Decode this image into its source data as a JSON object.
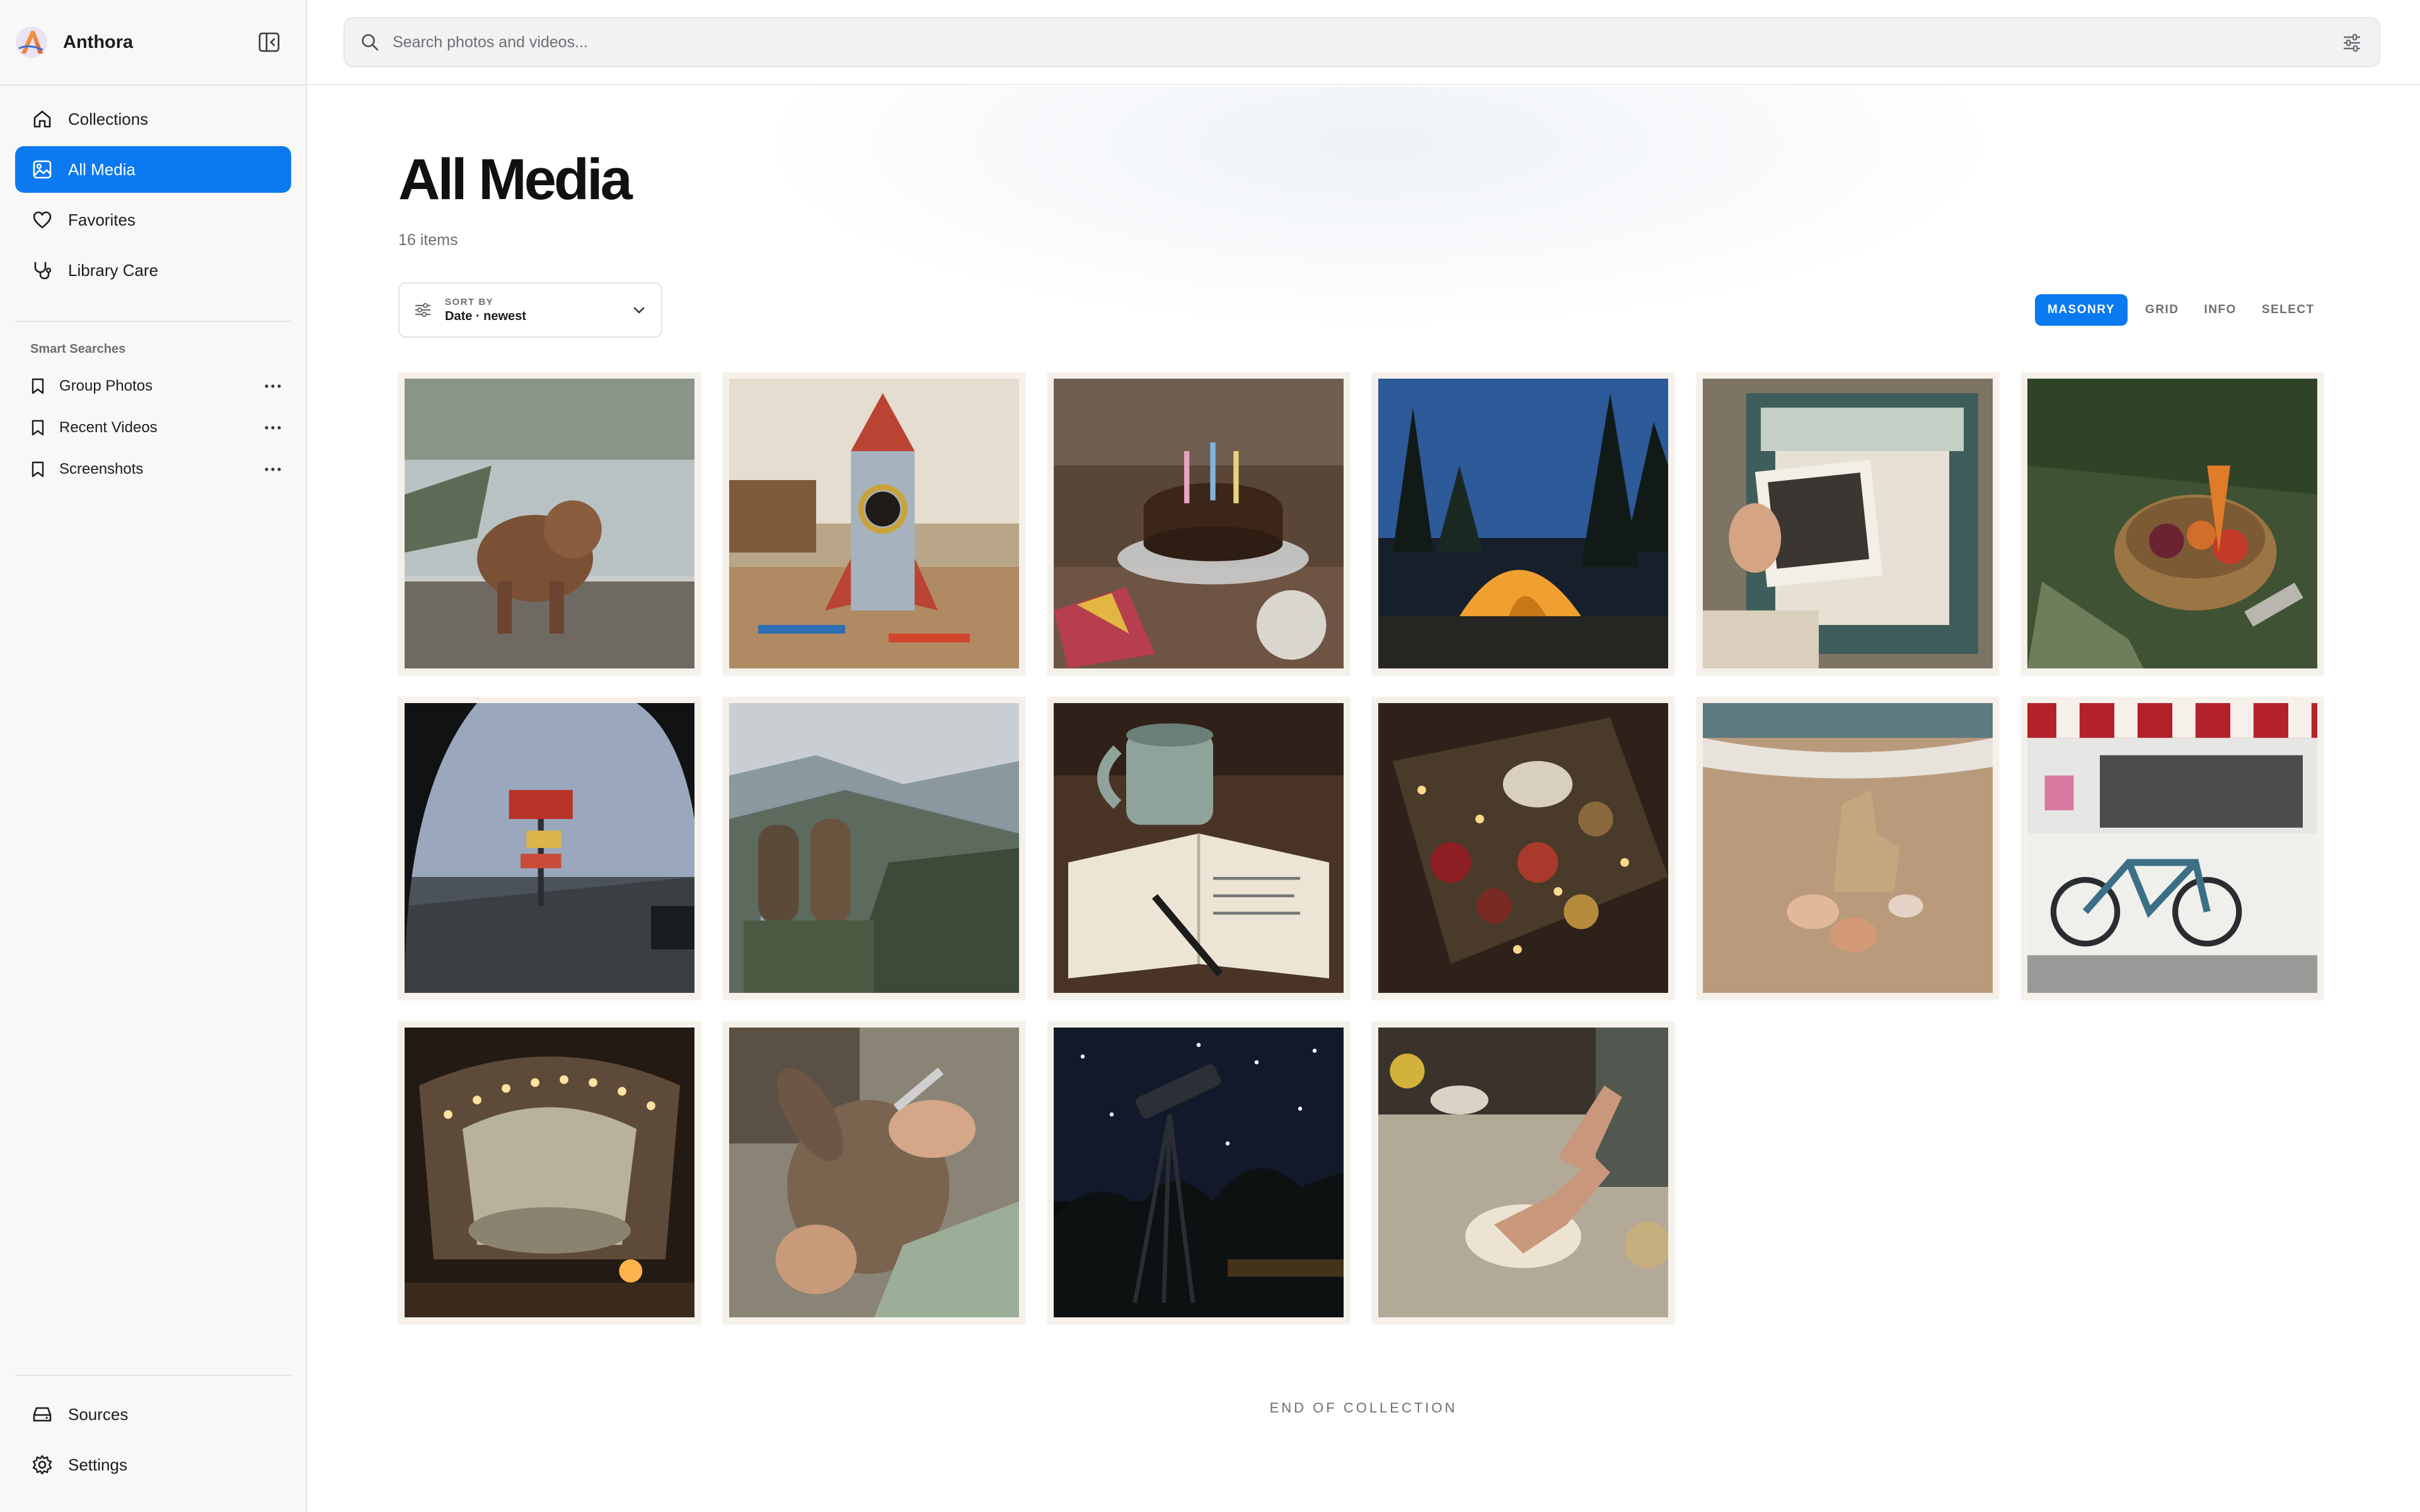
{
  "app": {
    "name": "Anthora"
  },
  "sidebar": {
    "nav": [
      {
        "label": "Collections",
        "icon": "home-icon"
      },
      {
        "label": "All Media",
        "icon": "image-icon",
        "active": true
      },
      {
        "label": "Favorites",
        "icon": "heart-icon"
      },
      {
        "label": "Library Care",
        "icon": "stethoscope-icon"
      }
    ],
    "smart_searches_title": "Smart Searches",
    "smart_searches": [
      {
        "label": "Group Photos"
      },
      {
        "label": "Recent Videos"
      },
      {
        "label": "Screenshots"
      }
    ],
    "bottom": [
      {
        "label": "Sources",
        "icon": "drive-icon"
      },
      {
        "label": "Settings",
        "icon": "gear-icon"
      }
    ]
  },
  "search": {
    "placeholder": "Search photos and videos..."
  },
  "main": {
    "title": "All Media",
    "count": "16 items",
    "sort": {
      "label": "SORT BY",
      "value": "Date · newest"
    },
    "views": [
      {
        "label": "MASONRY",
        "active": true
      },
      {
        "label": "GRID"
      },
      {
        "label": "INFO"
      },
      {
        "label": "SELECT"
      }
    ],
    "tiles": [
      "dog shaking water at lake shore",
      "cardboard rocket on craft table",
      "birthday cake with candles",
      "lit tent in forest at dusk",
      "box of old photographs",
      "basket of harvested vegetables",
      "motel sign through rainy car window",
      "hiking boots above mountain valley",
      "mug beside open journal",
      "box of holiday ornaments and lights",
      "sandcastle with seashells",
      "bicycle under striped awning",
      "blanket fort with string lights",
      "mending a stuffed bunny",
      "telescope under starry sky",
      "hands kneading dough"
    ],
    "end_label": "END OF COLLECTION"
  },
  "colors": {
    "accent": "#0b79f0",
    "sidebar_bg": "#f8f8f9",
    "tile_border": "#f5f1ea"
  }
}
